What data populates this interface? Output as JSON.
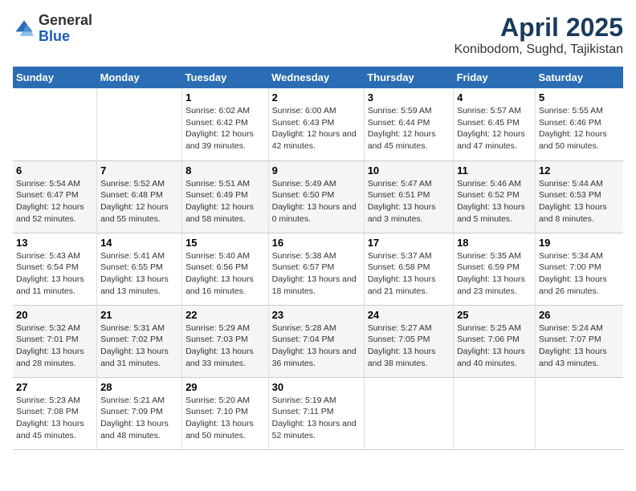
{
  "logo": {
    "general": "General",
    "blue": "Blue"
  },
  "title": "April 2025",
  "subtitle": "Konibodom, Sughd, Tajikistan",
  "days_header": [
    "Sunday",
    "Monday",
    "Tuesday",
    "Wednesday",
    "Thursday",
    "Friday",
    "Saturday"
  ],
  "weeks": [
    [
      {
        "day": "",
        "info": ""
      },
      {
        "day": "",
        "info": ""
      },
      {
        "day": "1",
        "info": "Sunrise: 6:02 AM\nSunset: 6:42 PM\nDaylight: 12 hours and 39 minutes."
      },
      {
        "day": "2",
        "info": "Sunrise: 6:00 AM\nSunset: 6:43 PM\nDaylight: 12 hours and 42 minutes."
      },
      {
        "day": "3",
        "info": "Sunrise: 5:59 AM\nSunset: 6:44 PM\nDaylight: 12 hours and 45 minutes."
      },
      {
        "day": "4",
        "info": "Sunrise: 5:57 AM\nSunset: 6:45 PM\nDaylight: 12 hours and 47 minutes."
      },
      {
        "day": "5",
        "info": "Sunrise: 5:55 AM\nSunset: 6:46 PM\nDaylight: 12 hours and 50 minutes."
      }
    ],
    [
      {
        "day": "6",
        "info": "Sunrise: 5:54 AM\nSunset: 6:47 PM\nDaylight: 12 hours and 52 minutes."
      },
      {
        "day": "7",
        "info": "Sunrise: 5:52 AM\nSunset: 6:48 PM\nDaylight: 12 hours and 55 minutes."
      },
      {
        "day": "8",
        "info": "Sunrise: 5:51 AM\nSunset: 6:49 PM\nDaylight: 12 hours and 58 minutes."
      },
      {
        "day": "9",
        "info": "Sunrise: 5:49 AM\nSunset: 6:50 PM\nDaylight: 13 hours and 0 minutes."
      },
      {
        "day": "10",
        "info": "Sunrise: 5:47 AM\nSunset: 6:51 PM\nDaylight: 13 hours and 3 minutes."
      },
      {
        "day": "11",
        "info": "Sunrise: 5:46 AM\nSunset: 6:52 PM\nDaylight: 13 hours and 5 minutes."
      },
      {
        "day": "12",
        "info": "Sunrise: 5:44 AM\nSunset: 6:53 PM\nDaylight: 13 hours and 8 minutes."
      }
    ],
    [
      {
        "day": "13",
        "info": "Sunrise: 5:43 AM\nSunset: 6:54 PM\nDaylight: 13 hours and 11 minutes."
      },
      {
        "day": "14",
        "info": "Sunrise: 5:41 AM\nSunset: 6:55 PM\nDaylight: 13 hours and 13 minutes."
      },
      {
        "day": "15",
        "info": "Sunrise: 5:40 AM\nSunset: 6:56 PM\nDaylight: 13 hours and 16 minutes."
      },
      {
        "day": "16",
        "info": "Sunrise: 5:38 AM\nSunset: 6:57 PM\nDaylight: 13 hours and 18 minutes."
      },
      {
        "day": "17",
        "info": "Sunrise: 5:37 AM\nSunset: 6:58 PM\nDaylight: 13 hours and 21 minutes."
      },
      {
        "day": "18",
        "info": "Sunrise: 5:35 AM\nSunset: 6:59 PM\nDaylight: 13 hours and 23 minutes."
      },
      {
        "day": "19",
        "info": "Sunrise: 5:34 AM\nSunset: 7:00 PM\nDaylight: 13 hours and 26 minutes."
      }
    ],
    [
      {
        "day": "20",
        "info": "Sunrise: 5:32 AM\nSunset: 7:01 PM\nDaylight: 13 hours and 28 minutes."
      },
      {
        "day": "21",
        "info": "Sunrise: 5:31 AM\nSunset: 7:02 PM\nDaylight: 13 hours and 31 minutes."
      },
      {
        "day": "22",
        "info": "Sunrise: 5:29 AM\nSunset: 7:03 PM\nDaylight: 13 hours and 33 minutes."
      },
      {
        "day": "23",
        "info": "Sunrise: 5:28 AM\nSunset: 7:04 PM\nDaylight: 13 hours and 36 minutes."
      },
      {
        "day": "24",
        "info": "Sunrise: 5:27 AM\nSunset: 7:05 PM\nDaylight: 13 hours and 38 minutes."
      },
      {
        "day": "25",
        "info": "Sunrise: 5:25 AM\nSunset: 7:06 PM\nDaylight: 13 hours and 40 minutes."
      },
      {
        "day": "26",
        "info": "Sunrise: 5:24 AM\nSunset: 7:07 PM\nDaylight: 13 hours and 43 minutes."
      }
    ],
    [
      {
        "day": "27",
        "info": "Sunrise: 5:23 AM\nSunset: 7:08 PM\nDaylight: 13 hours and 45 minutes."
      },
      {
        "day": "28",
        "info": "Sunrise: 5:21 AM\nSunset: 7:09 PM\nDaylight: 13 hours and 48 minutes."
      },
      {
        "day": "29",
        "info": "Sunrise: 5:20 AM\nSunset: 7:10 PM\nDaylight: 13 hours and 50 minutes."
      },
      {
        "day": "30",
        "info": "Sunrise: 5:19 AM\nSunset: 7:11 PM\nDaylight: 13 hours and 52 minutes."
      },
      {
        "day": "",
        "info": ""
      },
      {
        "day": "",
        "info": ""
      },
      {
        "day": "",
        "info": ""
      }
    ]
  ]
}
